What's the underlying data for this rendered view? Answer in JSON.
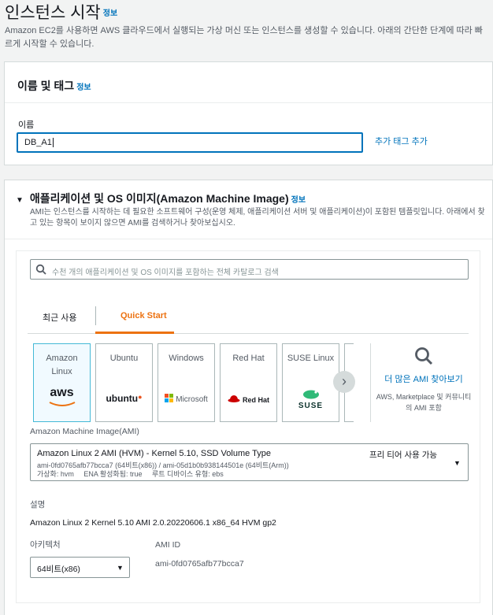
{
  "page": {
    "title": "인스턴스 시작",
    "info": "정보",
    "description": "Amazon EC2를 사용하면 AWS 클라우드에서 실행되는 가상 머신 또는 인스턴스를 생성할 수 있습니다. 아래의 간단한 단계에 따라 빠르게 시작할 수 있습니다."
  },
  "name_tags": {
    "header": "이름 및 태그",
    "info": "정보",
    "name_label": "이름",
    "name_value": "DB_A1",
    "add_tag": "추가 태그 추가"
  },
  "ami": {
    "header": "애플리케이션 및 OS 이미지(Amazon Machine Image)",
    "info": "정보",
    "description": "AMI는 인스턴스를 시작하는 데 필요한 소프트웨어 구성(운영 체제, 애플리케이션 서버 및 애플리케이션)이 포함된 템플릿입니다. 아래에서 찾고 있는 항목이 보이지 않으면 AMI를 검색하거나 찾아보십시오.",
    "search_placeholder": "수천 개의 애플리케이션 및 OS 이미지를 포함하는 전체 카탈로그 검색",
    "tabs": {
      "recent": "최근 사용",
      "quick_start": "Quick Start"
    },
    "tiles": [
      {
        "name": "Amazon Linux",
        "logo": "aws"
      },
      {
        "name": "Ubuntu",
        "logo": "ubuntu"
      },
      {
        "name": "Windows",
        "logo": "Microsoft"
      },
      {
        "name": "Red Hat",
        "logo": "Red Hat"
      },
      {
        "name": "SUSE Linux",
        "logo": "SUSE"
      }
    ],
    "more": {
      "label": "더 많은 AMI 찾아보기",
      "sub": "AWS, Marketplace 및 커뮤니티의 AMI 포함"
    },
    "ami_label": "Amazon Machine Image(AMI)",
    "selected": {
      "title": "Amazon Linux 2 AMI (HVM) - Kernel 5.10, SSD Volume Type",
      "ids": "ami-0fd0765afb77bcca7 (64비트(x86)) / ami-05d1b0b938144501e (64비트(Arm))",
      "meta": "가상화: hvm     ENA 활성화됨: true     루트 디바이스 유형: ebs",
      "free_tier": "프리 티어 사용 가능"
    },
    "desc_label": "설명",
    "desc_value": "Amazon Linux 2 Kernel 5.10 AMI 2.0.20220606.1 x86_64 HVM gp2",
    "arch_label": "아키텍처",
    "arch_value": "64비트(x86)",
    "amiid_label": "AMI ID",
    "amiid_value": "ami-0fd0765afb77bcca7"
  },
  "colors": {
    "accent": "#ec7211",
    "link": "#0073bb",
    "selected_border": "#44b9d6"
  }
}
